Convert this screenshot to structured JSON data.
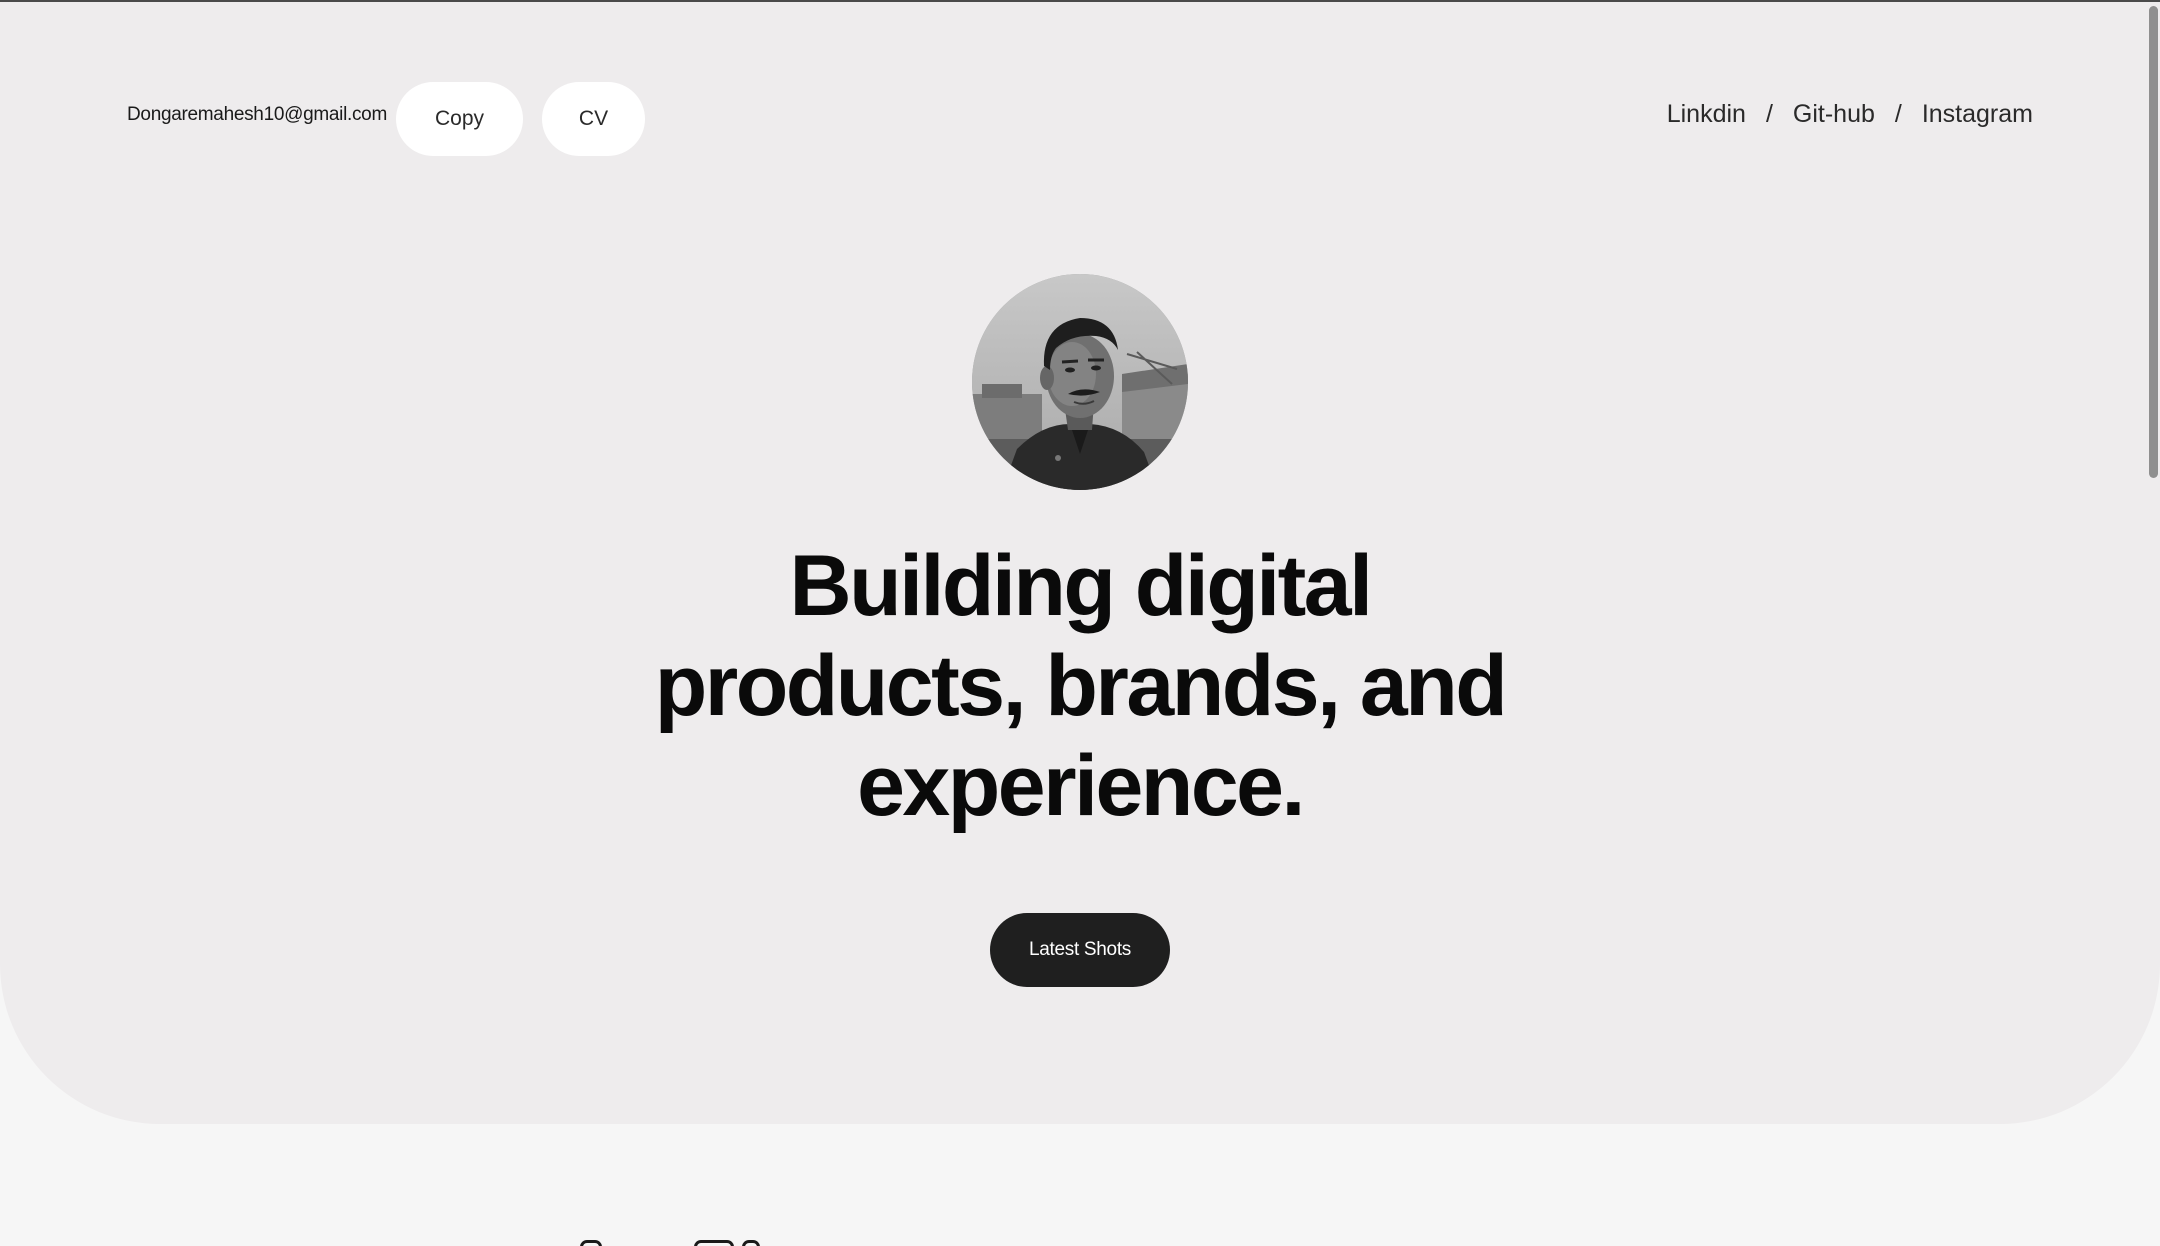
{
  "header": {
    "email": "Dongaremahesh10@gmail.com",
    "copy_label": "Copy",
    "cv_label": "CV"
  },
  "social": {
    "links": [
      "Linkdin",
      "Git-hub",
      "Instagram"
    ],
    "separator": "/"
  },
  "hero": {
    "avatar_icon": "profile-photo",
    "headline_lines": [
      "Building digital",
      "products, brands, and",
      "experience."
    ],
    "cta_label": "Latest Shots"
  },
  "colors": {
    "hero_background": "#eeeced",
    "page_background": "#f6f6f6",
    "cta_background": "#1f1f1f",
    "pill_background": "#ffffff"
  }
}
